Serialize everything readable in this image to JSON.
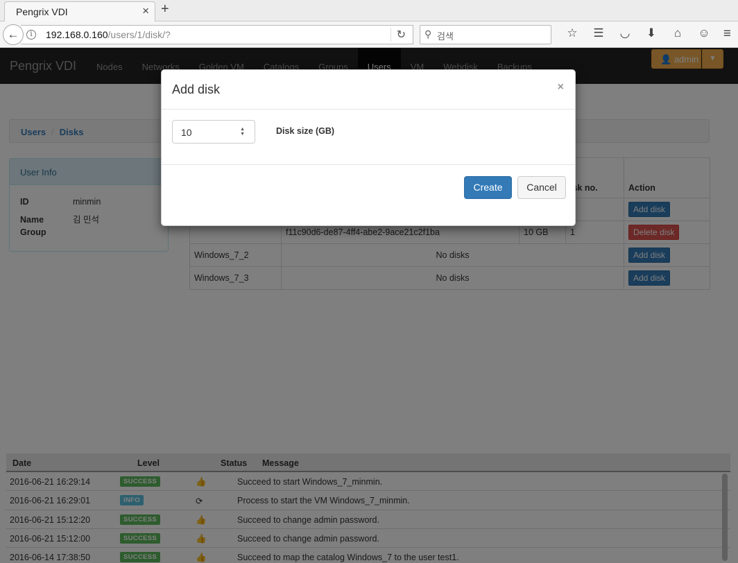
{
  "browser": {
    "tab_title": "Pengrix VDI",
    "url_host": "192.168.0.160",
    "url_path": "/users/1/disk/?",
    "search_placeholder": "검색"
  },
  "app": {
    "brand": "Pengrix VDI",
    "nav": [
      "Nodes",
      "Networks",
      "Golden VM",
      "Catalogs",
      "Groups",
      "Users",
      "VM",
      "Webdisk",
      "Backups"
    ],
    "active_nav": "Users",
    "user_button": "admin"
  },
  "breadcrumb": [
    "Users",
    "Disks"
  ],
  "user_info": {
    "heading": "User Info",
    "rows": [
      {
        "key": "ID",
        "value": "minmin"
      },
      {
        "key": "Name",
        "value": "김 민석"
      },
      {
        "key": "Group",
        "value": ""
      }
    ]
  },
  "disk_table": {
    "headers": [
      "",
      "",
      "isk no.",
      "Action"
    ],
    "rows": [
      {
        "vm": "",
        "uuid": "",
        "size": "",
        "no": "",
        "action": "Add disk",
        "type": "primary"
      },
      {
        "vm": "",
        "uuid": "f11c90d6-de87-4ff4-abe2-9ace21c2f1ba",
        "size": "10 GB",
        "no": "1",
        "action": "Delete disk",
        "type": "danger"
      },
      {
        "vm": "Windows_7_2",
        "uuid": "No disks",
        "size": "",
        "no": "",
        "action": "Add disk",
        "type": "primary"
      },
      {
        "vm": "Windows_7_3",
        "uuid": "No disks",
        "size": "",
        "no": "",
        "action": "Add disk",
        "type": "primary"
      }
    ]
  },
  "log": {
    "headers": {
      "date": "Date",
      "level": "Level",
      "status": "Status",
      "message": "Message"
    },
    "rows": [
      {
        "date": "2016-06-21 16:29:14",
        "level": "SUCCESS",
        "status": "thumbs-up-icon",
        "message": "Succeed to start Windows_7_minmin."
      },
      {
        "date": "2016-06-21 16:29:01",
        "level": "INFO",
        "status": "refresh-icon",
        "message": "Process to start the VM Windows_7_minmin."
      },
      {
        "date": "2016-06-21 15:12:20",
        "level": "SUCCESS",
        "status": "thumbs-up-icon",
        "message": "Succeed to change admin password."
      },
      {
        "date": "2016-06-21 15:12:00",
        "level": "SUCCESS",
        "status": "thumbs-up-icon",
        "message": "Succeed to change admin password."
      },
      {
        "date": "2016-06-14 17:38:50",
        "level": "SUCCESS",
        "status": "thumbs-up-icon",
        "message": "Succeed to map the catalog Windows_7 to the user test1."
      }
    ]
  },
  "modal": {
    "title": "Add disk",
    "close": "×",
    "size_value": "10",
    "size_label": "Disk size (GB)",
    "create_label": "Create",
    "cancel_label": "Cancel"
  }
}
